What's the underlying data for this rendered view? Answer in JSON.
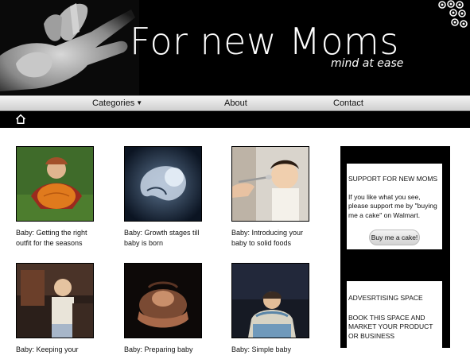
{
  "header": {
    "title": "For new Moms",
    "tagline": "mind at ease"
  },
  "nav": {
    "categories": "Categories",
    "about": "About",
    "contact": "Contact"
  },
  "posts": [
    {
      "caption": "Baby: Getting the right outfit for the seasons",
      "image": "baby-pumpkin-photo"
    },
    {
      "caption": "Baby: Growth stages till baby is born",
      "image": "ultrasound-photo"
    },
    {
      "caption": "Baby: Introducing your baby to solid foods",
      "image": "baby-spoon-feeding-photo"
    },
    {
      "caption": "Baby: Keeping your",
      "image": "toddler-bedroom-photo"
    },
    {
      "caption": "Baby: Preparing baby",
      "image": "hands-baby-photo"
    },
    {
      "caption": "Baby: Simple baby",
      "image": "mother-carrying-baby-photo"
    }
  ],
  "sidebar": {
    "support": {
      "title": "SUPPORT FOR NEW MOMS",
      "text": "If you like what you see, please support me by \"buying me a cake\" on Walmart.",
      "button": "Buy me a cake!"
    },
    "ads": {
      "title": "ADVESRTISING SPACE",
      "text": "BOOK THIS SPACE AND MARKET YOUR PRODUCT OR BUSINESS"
    }
  },
  "colors": {
    "header_bg": "#000000",
    "nav_bg": "#dcdcdc",
    "page_bg": "#ffffff",
    "sidebar_bg": "#000000"
  }
}
